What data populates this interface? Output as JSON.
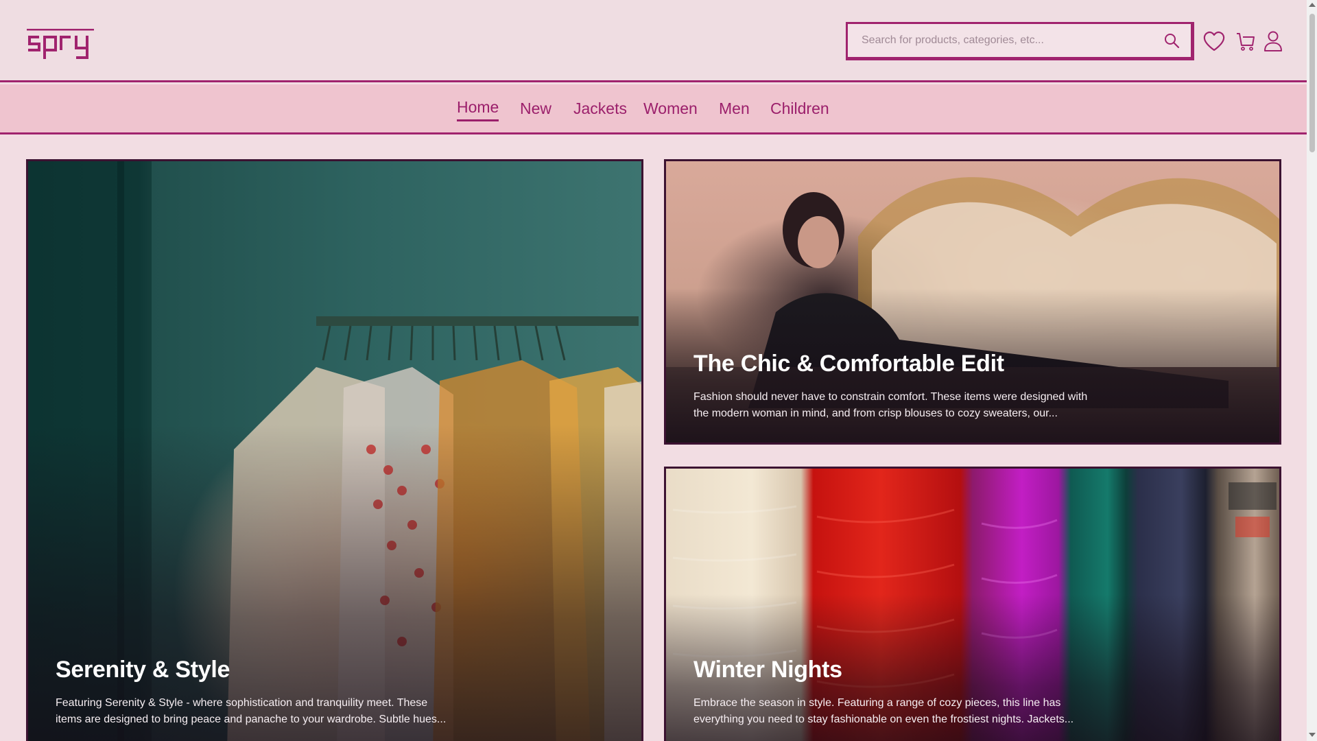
{
  "brand": {
    "name": "spry",
    "color": "#a0236e"
  },
  "search": {
    "placeholder": "Search for products, categories, etc...",
    "value": ""
  },
  "header_icons": [
    "heart-icon",
    "cart-icon",
    "user-icon"
  ],
  "nav": {
    "items": [
      {
        "label": "Home",
        "active": true
      },
      {
        "label": "New"
      },
      {
        "label": "Jackets"
      },
      {
        "label": "Women"
      },
      {
        "label": "Men"
      },
      {
        "label": "Children"
      }
    ]
  },
  "cards": [
    {
      "title": "Serenity & Style",
      "description": "Featuring Serenity & Style - where sophistication and tranquility meet. These items are designed to bring peace and panache to your wardrobe. Subtle hues..."
    },
    {
      "title": "The Chic & Comfortable Edit",
      "description": "Fashion should never have to constrain comfort. These items were designed with the modern woman in mind, and from crisp blouses to cozy sweaters, our..."
    },
    {
      "title": "Winter Nights",
      "description": "Embrace the season in style. Featuring a range of cozy pieces, this line has everything you need to stay fashionable on even the frostiest nights. Jackets..."
    }
  ]
}
